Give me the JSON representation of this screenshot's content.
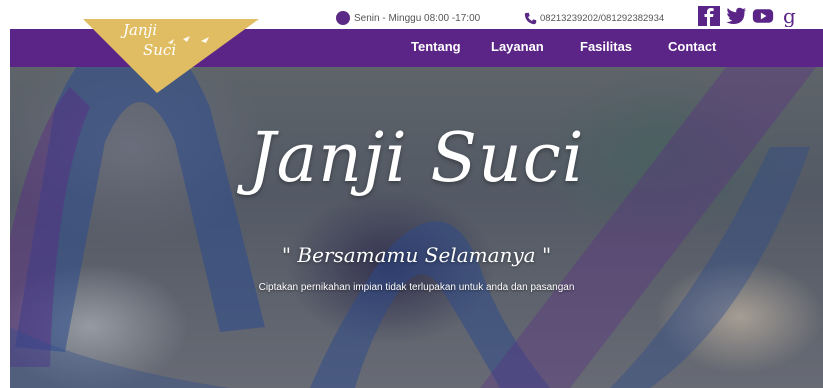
{
  "topbar": {
    "hours": "Senin - Minggu 08:00 -17:00",
    "phone": "08213239202/081292382934",
    "social": [
      "facebook-icon",
      "twitter-icon",
      "youtube-icon",
      "google-plus-icon"
    ]
  },
  "logo": {
    "line1": "Janji",
    "line2": "Suci"
  },
  "nav": {
    "items": [
      {
        "label": "Tentang"
      },
      {
        "label": "Layanan"
      },
      {
        "label": "Fasilitas"
      },
      {
        "label": "Contact"
      }
    ]
  },
  "hero": {
    "title": "Janji Suci",
    "tagline": "\" Bersamamu Selamanya \"",
    "subtitle": "Ciptakan pernikahan impian tidak terlupakan untuk anda dan pasangan"
  },
  "colors": {
    "nav": "#5b2487",
    "logo_gold": "#e0bd63",
    "overlay_blue": "#2c4a8c",
    "overlay_purple": "#5b2a86"
  }
}
